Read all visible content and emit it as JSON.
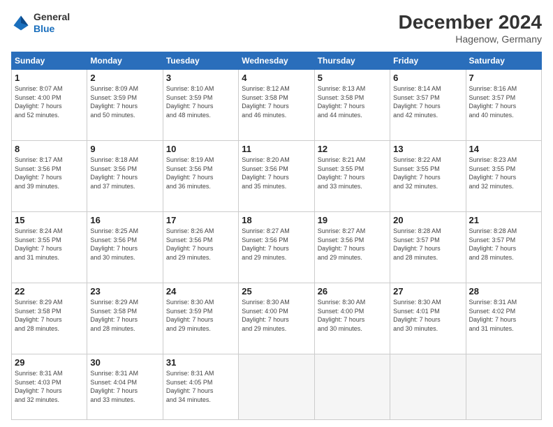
{
  "header": {
    "logo_line1": "General",
    "logo_line2": "Blue",
    "month_title": "December 2024",
    "subtitle": "Hagenow, Germany"
  },
  "weekdays": [
    "Sunday",
    "Monday",
    "Tuesday",
    "Wednesday",
    "Thursday",
    "Friday",
    "Saturday"
  ],
  "weeks": [
    [
      {
        "day": "1",
        "info": "Sunrise: 8:07 AM\nSunset: 4:00 PM\nDaylight: 7 hours\nand 52 minutes."
      },
      {
        "day": "2",
        "info": "Sunrise: 8:09 AM\nSunset: 3:59 PM\nDaylight: 7 hours\nand 50 minutes."
      },
      {
        "day": "3",
        "info": "Sunrise: 8:10 AM\nSunset: 3:59 PM\nDaylight: 7 hours\nand 48 minutes."
      },
      {
        "day": "4",
        "info": "Sunrise: 8:12 AM\nSunset: 3:58 PM\nDaylight: 7 hours\nand 46 minutes."
      },
      {
        "day": "5",
        "info": "Sunrise: 8:13 AM\nSunset: 3:58 PM\nDaylight: 7 hours\nand 44 minutes."
      },
      {
        "day": "6",
        "info": "Sunrise: 8:14 AM\nSunset: 3:57 PM\nDaylight: 7 hours\nand 42 minutes."
      },
      {
        "day": "7",
        "info": "Sunrise: 8:16 AM\nSunset: 3:57 PM\nDaylight: 7 hours\nand 40 minutes."
      }
    ],
    [
      {
        "day": "8",
        "info": "Sunrise: 8:17 AM\nSunset: 3:56 PM\nDaylight: 7 hours\nand 39 minutes."
      },
      {
        "day": "9",
        "info": "Sunrise: 8:18 AM\nSunset: 3:56 PM\nDaylight: 7 hours\nand 37 minutes."
      },
      {
        "day": "10",
        "info": "Sunrise: 8:19 AM\nSunset: 3:56 PM\nDaylight: 7 hours\nand 36 minutes."
      },
      {
        "day": "11",
        "info": "Sunrise: 8:20 AM\nSunset: 3:56 PM\nDaylight: 7 hours\nand 35 minutes."
      },
      {
        "day": "12",
        "info": "Sunrise: 8:21 AM\nSunset: 3:55 PM\nDaylight: 7 hours\nand 33 minutes."
      },
      {
        "day": "13",
        "info": "Sunrise: 8:22 AM\nSunset: 3:55 PM\nDaylight: 7 hours\nand 32 minutes."
      },
      {
        "day": "14",
        "info": "Sunrise: 8:23 AM\nSunset: 3:55 PM\nDaylight: 7 hours\nand 32 minutes."
      }
    ],
    [
      {
        "day": "15",
        "info": "Sunrise: 8:24 AM\nSunset: 3:55 PM\nDaylight: 7 hours\nand 31 minutes."
      },
      {
        "day": "16",
        "info": "Sunrise: 8:25 AM\nSunset: 3:56 PM\nDaylight: 7 hours\nand 30 minutes."
      },
      {
        "day": "17",
        "info": "Sunrise: 8:26 AM\nSunset: 3:56 PM\nDaylight: 7 hours\nand 29 minutes."
      },
      {
        "day": "18",
        "info": "Sunrise: 8:27 AM\nSunset: 3:56 PM\nDaylight: 7 hours\nand 29 minutes."
      },
      {
        "day": "19",
        "info": "Sunrise: 8:27 AM\nSunset: 3:56 PM\nDaylight: 7 hours\nand 29 minutes."
      },
      {
        "day": "20",
        "info": "Sunrise: 8:28 AM\nSunset: 3:57 PM\nDaylight: 7 hours\nand 28 minutes."
      },
      {
        "day": "21",
        "info": "Sunrise: 8:28 AM\nSunset: 3:57 PM\nDaylight: 7 hours\nand 28 minutes."
      }
    ],
    [
      {
        "day": "22",
        "info": "Sunrise: 8:29 AM\nSunset: 3:58 PM\nDaylight: 7 hours\nand 28 minutes."
      },
      {
        "day": "23",
        "info": "Sunrise: 8:29 AM\nSunset: 3:58 PM\nDaylight: 7 hours\nand 28 minutes."
      },
      {
        "day": "24",
        "info": "Sunrise: 8:30 AM\nSunset: 3:59 PM\nDaylight: 7 hours\nand 29 minutes."
      },
      {
        "day": "25",
        "info": "Sunrise: 8:30 AM\nSunset: 4:00 PM\nDaylight: 7 hours\nand 29 minutes."
      },
      {
        "day": "26",
        "info": "Sunrise: 8:30 AM\nSunset: 4:00 PM\nDaylight: 7 hours\nand 30 minutes."
      },
      {
        "day": "27",
        "info": "Sunrise: 8:30 AM\nSunset: 4:01 PM\nDaylight: 7 hours\nand 30 minutes."
      },
      {
        "day": "28",
        "info": "Sunrise: 8:31 AM\nSunset: 4:02 PM\nDaylight: 7 hours\nand 31 minutes."
      }
    ],
    [
      {
        "day": "29",
        "info": "Sunrise: 8:31 AM\nSunset: 4:03 PM\nDaylight: 7 hours\nand 32 minutes."
      },
      {
        "day": "30",
        "info": "Sunrise: 8:31 AM\nSunset: 4:04 PM\nDaylight: 7 hours\nand 33 minutes."
      },
      {
        "day": "31",
        "info": "Sunrise: 8:31 AM\nSunset: 4:05 PM\nDaylight: 7 hours\nand 34 minutes."
      },
      {
        "day": "",
        "info": ""
      },
      {
        "day": "",
        "info": ""
      },
      {
        "day": "",
        "info": ""
      },
      {
        "day": "",
        "info": ""
      }
    ]
  ]
}
